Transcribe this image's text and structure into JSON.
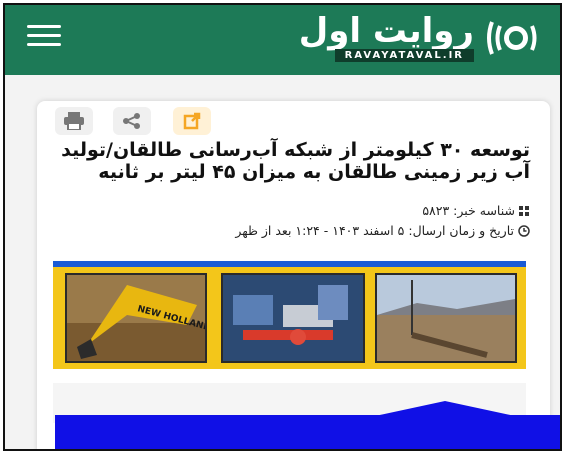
{
  "header": {
    "menu_icon": "hamburger-menu-icon",
    "logo_text": "روایت اول",
    "logo_subtext": "RAVAYATAVAL.IR",
    "background": "#1d7a57"
  },
  "toolbar": {
    "print_icon": "printer-icon",
    "share_icon": "share-icon",
    "open_icon": "external-link-icon"
  },
  "article": {
    "title": "توسعه ۳۰ کیلومتر از شبکه آب‌رسانی طالقان/تولید آب زیر زمینی طالقان به میزان ۴۵ لیتر بر ثانیه",
    "news_id": "شناسه خبر: ۵۸۲۳",
    "publish_time": "تاریخ و زمان ارسال: ۵ اسفند ۱۴۰۳ - ۱:۲۴ بعد از ظهر",
    "banner_caption": "NEW HOLLAND"
  },
  "colors": {
    "accent": "#f5a623",
    "overlay": "#1010e6",
    "banner": "#f3c61a"
  }
}
